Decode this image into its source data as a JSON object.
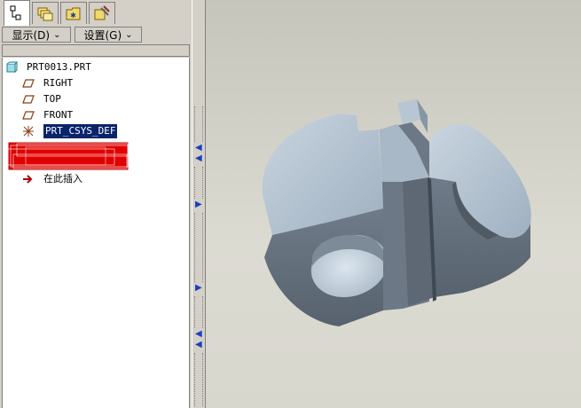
{
  "toolbar": {
    "tabs": [
      {
        "icon": "model-tree-icon"
      },
      {
        "icon": "layers-icon"
      },
      {
        "icon": "folder-icon"
      },
      {
        "icon": "favorites-tools-icon"
      }
    ],
    "display_label": "显示(D)",
    "settings_label": "设置(G)"
  },
  "tree": {
    "root": {
      "label": "PRT0013.PRT",
      "icon": "part-icon"
    },
    "items": [
      {
        "label": "RIGHT",
        "icon": "datum-plane-icon"
      },
      {
        "label": "TOP",
        "icon": "datum-plane-icon"
      },
      {
        "label": "FRONT",
        "icon": "datum-plane-icon"
      },
      {
        "label": "PRT_CSYS_DEF",
        "icon": "coordinate-system-icon",
        "selected": true
      }
    ],
    "insert_here": {
      "label": "在此插入",
      "icon": "insert-arrow-icon"
    }
  },
  "colors": {
    "selection": "#0a246a",
    "model_light": "#b9c8d6",
    "model_dark": "#5f6b78",
    "insert_arrow": "#b00000"
  }
}
